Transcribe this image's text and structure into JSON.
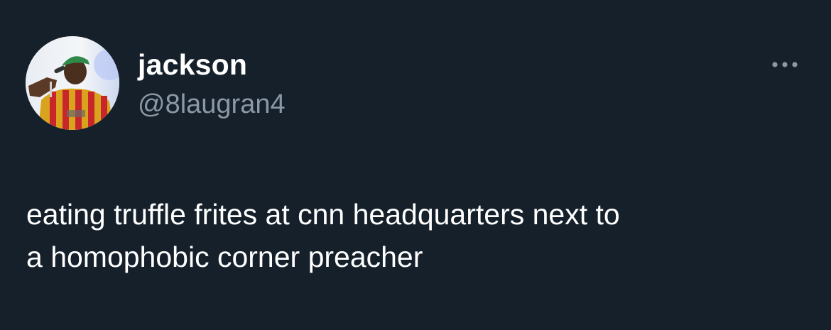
{
  "theme": {
    "background": "#15202b",
    "text_primary": "#ffffff",
    "text_secondary": "#8b98a5"
  },
  "author": {
    "display_name": "jackson",
    "handle": "@8laugran4",
    "avatar_icon": "profile-photo"
  },
  "menu": {
    "icon": "more-horizontal-icon"
  },
  "tweet": {
    "line_1": "eating truffle frites at cnn headquarters next to",
    "line_2": "a homophobic corner preacher"
  }
}
